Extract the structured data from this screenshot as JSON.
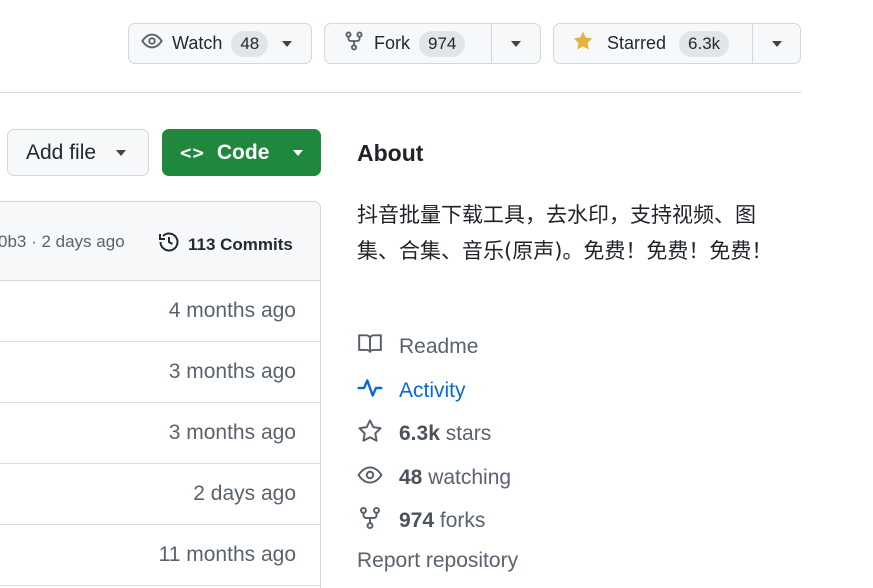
{
  "header": {
    "watch": {
      "label": "Watch",
      "count": "48"
    },
    "fork": {
      "label": "Fork",
      "count": "974"
    },
    "star": {
      "label": "Starred",
      "count": "6.3k",
      "star_color": "#e3b341"
    }
  },
  "toolbar": {
    "add_file_label": "Add file",
    "code_label": "Code",
    "code_glyph": "<>",
    "code_color": "#1f883d"
  },
  "commits": {
    "hash_text": "0b3 · 2 days ago",
    "count_label": "113 Commits",
    "rows": [
      "4 months ago",
      "3 months ago",
      "3 months ago",
      "2 days ago",
      "11 months ago"
    ]
  },
  "about": {
    "title": "About",
    "description": "抖音批量下载工具，去水印，支持视频、图集、合集、音乐(原声)。免费！免费！免费！",
    "readme": "Readme",
    "activity": "Activity",
    "stars_count": "6.3k",
    "stars_label": "stars",
    "watching_count": "48",
    "watching_label": "watching",
    "forks_count": "974",
    "forks_label": "forks",
    "report": "Report repository",
    "link_color": "#0969da"
  }
}
